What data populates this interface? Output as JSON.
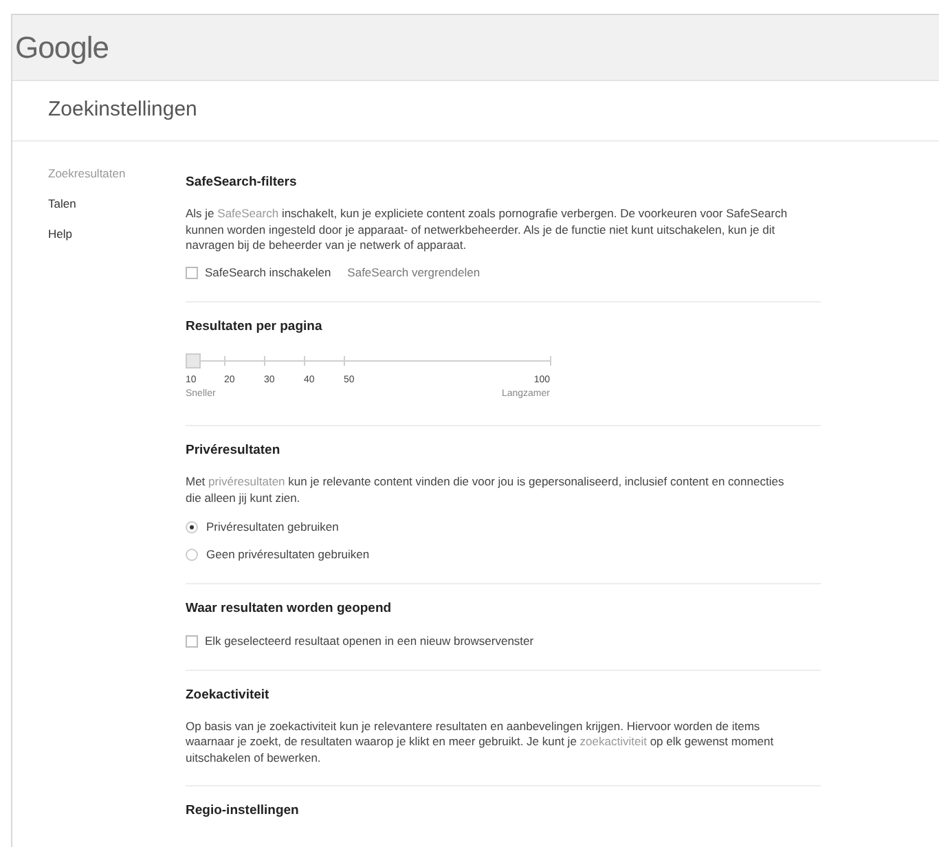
{
  "logo": "Google",
  "page_title": "Zoekinstellingen",
  "sidebar": {
    "items": [
      {
        "label": "Zoekresultaten",
        "selected": true
      },
      {
        "label": "Talen",
        "selected": false
      },
      {
        "label": "Help",
        "selected": false
      }
    ]
  },
  "sections": [
    {
      "kind": "safesearch",
      "title": "SafeSearch-filters",
      "paragraph": [
        {
          "kind": "text",
          "text": "Als je "
        },
        {
          "kind": "link",
          "text": "SafeSearch"
        },
        {
          "kind": "text",
          "text": " inschakelt, kun je expliciete content zoals pornografie verbergen. De voorkeuren voor SafeSearch kunnen worden ingesteld door je apparaat- of netwerkbeheerder. Als je de functie niet kunt uitschakelen, kun je dit navragen bij de beheerder van je netwerk of apparaat."
        }
      ],
      "checkbox": {
        "label": "SafeSearch inschakelen",
        "checked": false
      },
      "link": "SafeSearch vergrendelen"
    },
    {
      "kind": "slider",
      "title": "Resultaten per pagina",
      "level": 0,
      "ticks": [
        "10",
        "20",
        "30",
        "40",
        "50",
        "100"
      ],
      "left_label": "Sneller",
      "right_label": "Langzamer"
    },
    {
      "kind": "radios",
      "title": "Privéresultaten",
      "paragraph": [
        {
          "kind": "text",
          "text": "Met "
        },
        {
          "kind": "link",
          "text": "privéresultaten"
        },
        {
          "kind": "text",
          "text": " kun je relevante content vinden die voor jou is gepersonaliseerd, inclusief content en connecties die alleen jij kunt zien."
        }
      ],
      "options": [
        {
          "label": "Privéresultaten gebruiken",
          "selected": true
        },
        {
          "label": "Geen privéresultaten gebruiken",
          "selected": false
        }
      ]
    },
    {
      "kind": "checkbox",
      "title": "Waar resultaten worden geopend",
      "checkbox": {
        "label": "Elk geselecteerd resultaat openen in een nieuw browservenster",
        "checked": false
      }
    },
    {
      "kind": "text",
      "title": "Zoekactiviteit",
      "paragraph": [
        {
          "kind": "text",
          "text": "Op basis van je zoekactiviteit kun je relevantere resultaten en aanbevelingen krijgen. Hiervoor worden de items waarnaar je zoekt, de resultaten waarop je klikt en meer gebruikt. Je kunt je "
        },
        {
          "kind": "link",
          "text": "zoekactiviteit"
        },
        {
          "kind": "text",
          "text": " op elk gewenst moment uitschakelen of bewerken."
        }
      ]
    },
    {
      "kind": "heading",
      "title": "Regio-instellingen"
    }
  ]
}
